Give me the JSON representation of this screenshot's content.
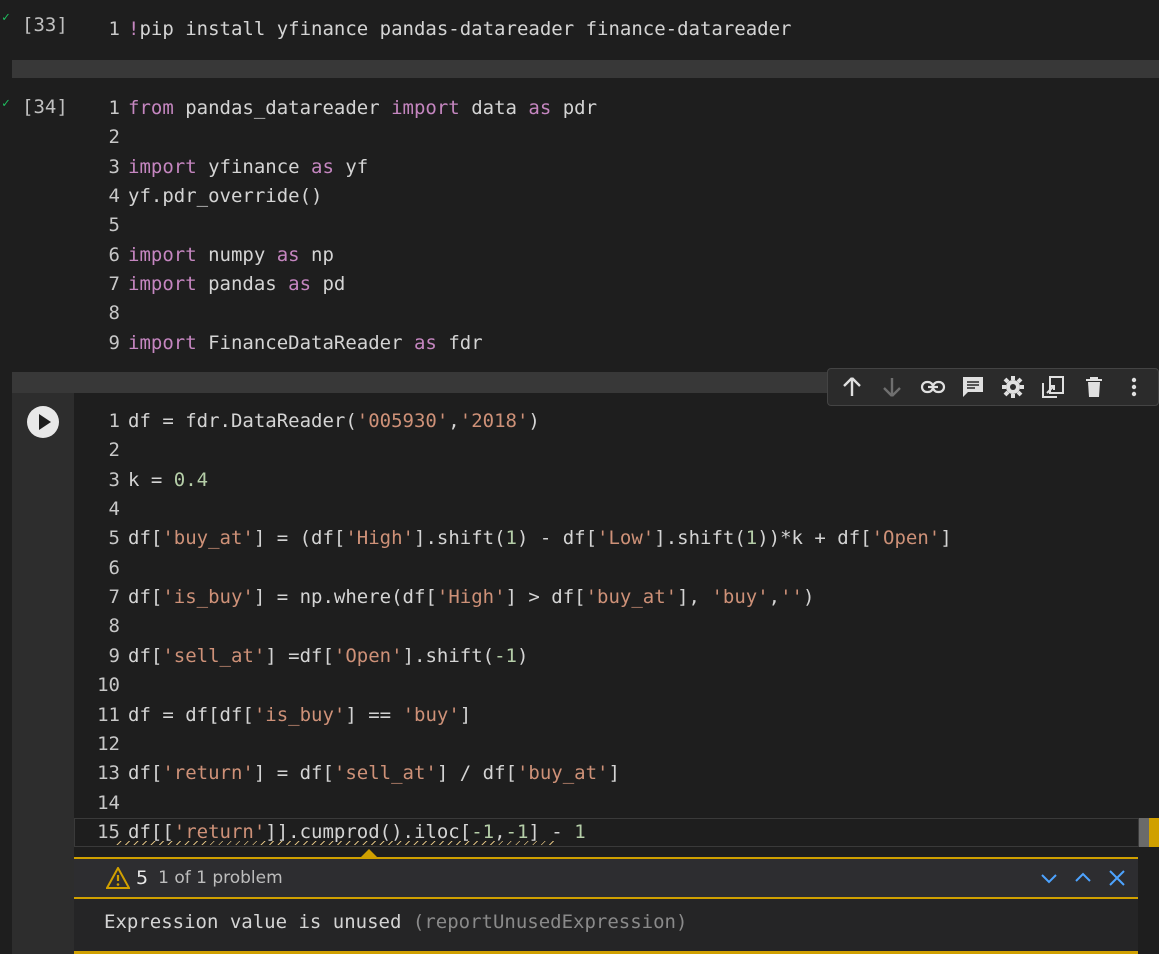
{
  "cells": [
    {
      "exec_count": "[33]",
      "lines": [
        [
          {
            "t": "!",
            "c": "kw"
          },
          {
            "t": "pip install yfinance pandas-datareader finance-datareader",
            "c": "plain"
          }
        ]
      ]
    },
    {
      "exec_count": "[34]",
      "lines": [
        [
          {
            "t": "from",
            "c": "kw"
          },
          {
            "t": " pandas_datareader ",
            "c": "plain"
          },
          {
            "t": "import",
            "c": "kw"
          },
          {
            "t": " data ",
            "c": "plain"
          },
          {
            "t": "as",
            "c": "kw"
          },
          {
            "t": " pdr",
            "c": "plain"
          }
        ],
        [],
        [
          {
            "t": "import",
            "c": "kw"
          },
          {
            "t": " yfinance ",
            "c": "plain"
          },
          {
            "t": "as",
            "c": "kw"
          },
          {
            "t": " yf",
            "c": "plain"
          }
        ],
        [
          {
            "t": "yf.pdr_override()",
            "c": "plain"
          }
        ],
        [],
        [
          {
            "t": "import",
            "c": "kw"
          },
          {
            "t": " numpy ",
            "c": "plain"
          },
          {
            "t": "as",
            "c": "kw"
          },
          {
            "t": " np",
            "c": "plain"
          }
        ],
        [
          {
            "t": "import",
            "c": "kw"
          },
          {
            "t": " pandas ",
            "c": "plain"
          },
          {
            "t": "as",
            "c": "kw"
          },
          {
            "t": " pd",
            "c": "plain"
          }
        ],
        [],
        [
          {
            "t": "import",
            "c": "kw"
          },
          {
            "t": " FinanceDataReader ",
            "c": "plain"
          },
          {
            "t": "as",
            "c": "kw"
          },
          {
            "t": " fdr",
            "c": "plain"
          }
        ]
      ]
    },
    {
      "exec_count": "",
      "lines": [
        [
          {
            "t": "df = fdr.DataReader(",
            "c": "plain"
          },
          {
            "t": "'005930'",
            "c": "str"
          },
          {
            "t": ",",
            "c": "plain"
          },
          {
            "t": "'2018'",
            "c": "str"
          },
          {
            "t": ")",
            "c": "plain"
          }
        ],
        [],
        [
          {
            "t": "k = ",
            "c": "plain"
          },
          {
            "t": "0.4",
            "c": "num"
          }
        ],
        [],
        [
          {
            "t": "df[",
            "c": "plain"
          },
          {
            "t": "'buy_at'",
            "c": "str"
          },
          {
            "t": "] = (df[",
            "c": "plain"
          },
          {
            "t": "'High'",
            "c": "str"
          },
          {
            "t": "].shift(",
            "c": "plain"
          },
          {
            "t": "1",
            "c": "num"
          },
          {
            "t": ") - df[",
            "c": "plain"
          },
          {
            "t": "'Low'",
            "c": "str"
          },
          {
            "t": "].shift(",
            "c": "plain"
          },
          {
            "t": "1",
            "c": "num"
          },
          {
            "t": "))*k + df[",
            "c": "plain"
          },
          {
            "t": "'Open'",
            "c": "str"
          },
          {
            "t": "]",
            "c": "plain"
          }
        ],
        [],
        [
          {
            "t": "df[",
            "c": "plain"
          },
          {
            "t": "'is_buy'",
            "c": "str"
          },
          {
            "t": "] = np.where(df[",
            "c": "plain"
          },
          {
            "t": "'High'",
            "c": "str"
          },
          {
            "t": "] > df[",
            "c": "plain"
          },
          {
            "t": "'buy_at'",
            "c": "str"
          },
          {
            "t": "], ",
            "c": "plain"
          },
          {
            "t": "'buy'",
            "c": "str"
          },
          {
            "t": ",",
            "c": "plain"
          },
          {
            "t": "''",
            "c": "str"
          },
          {
            "t": ")",
            "c": "plain"
          }
        ],
        [],
        [
          {
            "t": "df[",
            "c": "plain"
          },
          {
            "t": "'sell_at'",
            "c": "str"
          },
          {
            "t": "] =df[",
            "c": "plain"
          },
          {
            "t": "'Open'",
            "c": "str"
          },
          {
            "t": "].shift(",
            "c": "plain"
          },
          {
            "t": "-1",
            "c": "num"
          },
          {
            "t": ")",
            "c": "plain"
          }
        ],
        [],
        [
          {
            "t": "df = df[df[",
            "c": "plain"
          },
          {
            "t": "'is_buy'",
            "c": "str"
          },
          {
            "t": "] == ",
            "c": "plain"
          },
          {
            "t": "'buy'",
            "c": "str"
          },
          {
            "t": "]",
            "c": "plain"
          }
        ],
        [],
        [
          {
            "t": "df[",
            "c": "plain"
          },
          {
            "t": "'return'",
            "c": "str"
          },
          {
            "t": "] = df[",
            "c": "plain"
          },
          {
            "t": "'sell_at'",
            "c": "str"
          },
          {
            "t": "] / df[",
            "c": "plain"
          },
          {
            "t": "'buy_at'",
            "c": "str"
          },
          {
            "t": "]",
            "c": "plain"
          }
        ],
        [],
        [
          {
            "t": "df[[",
            "c": "plain"
          },
          {
            "t": "'return'",
            "c": "str"
          },
          {
            "t": "]].cumprod().iloc[",
            "c": "plain"
          },
          {
            "t": "-1",
            "c": "num"
          },
          {
            "t": ",",
            "c": "plain"
          },
          {
            "t": "-1",
            "c": "num"
          },
          {
            "t": "] - ",
            "c": "plain"
          },
          {
            "t": "1",
            "c": "num"
          }
        ]
      ]
    }
  ],
  "toolbar": {
    "icons": [
      "arrow-up-icon",
      "arrow-down-icon",
      "link-icon",
      "comment-icon",
      "gear-icon",
      "mirror-cell-icon",
      "trash-icon",
      "more-vert-icon"
    ]
  },
  "problems": {
    "count": "5",
    "summary": "1 of 1 problem",
    "message": "Expression value is unused",
    "rule": "(reportUnusedExpression)"
  },
  "colors": {
    "keyword": "#c586c0",
    "string": "#ce9178",
    "number": "#b5cea8",
    "warning": "#d0a000"
  }
}
